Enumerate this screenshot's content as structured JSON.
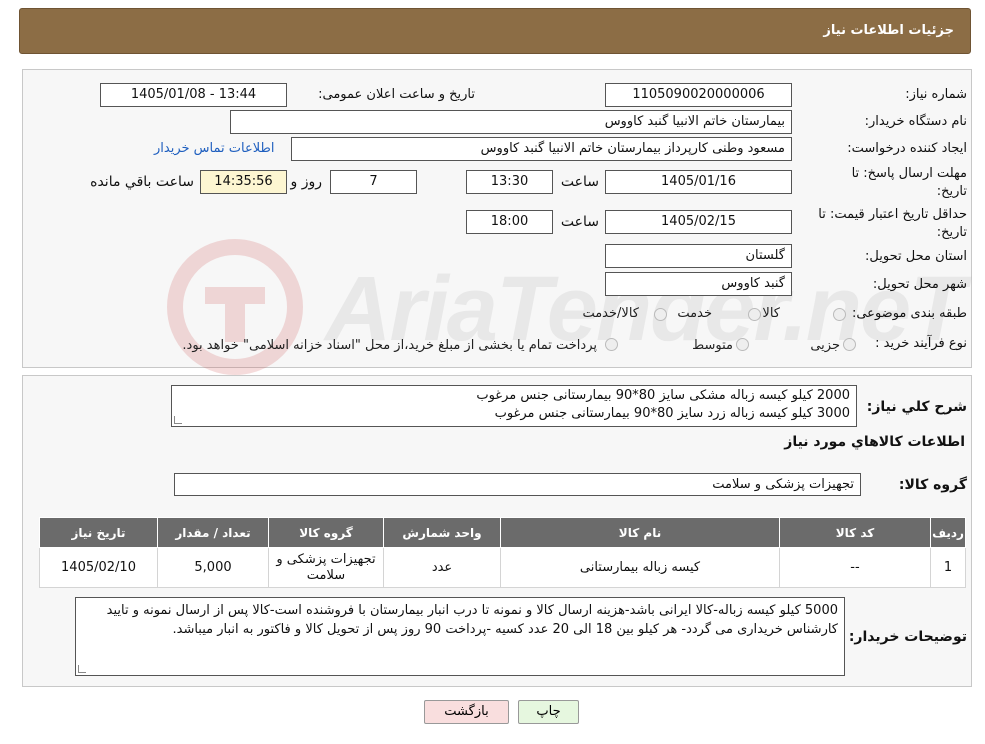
{
  "header": {
    "title": "جزئیات اطلاعات نیاز"
  },
  "fields": {
    "need_number_label": "شماره نیاز:",
    "need_number": "1105090020000006",
    "announce_label": "تاریخ و ساعت اعلان عمومی:",
    "announce_value": "1405/01/08 - 13:44",
    "buyer_org_label": "نام دستگاه خریدار:",
    "buyer_org": "بیمارستان خاتم الانبیا گنبد کاووس",
    "creator_label": "ایجاد کننده درخواست:",
    "creator": "مسعود وطنی کارپرداز بیمارستان خاتم الانبیا گنبد کاووس",
    "contact_link": "اطلاعات تماس خریدار",
    "deadline_label_1": "مهلت ارسال پاسخ: تا",
    "deadline_label_2": "تاریخ:",
    "deadline_date": "1405/01/16",
    "time_word": "ساعت",
    "deadline_time": "13:30",
    "days_value": "7",
    "days_word": "روز و",
    "remaining_time": "14:35:56",
    "remaining_word": "ساعت باقي مانده",
    "validity_label_1": "حداقل تاریخ اعتبار قیمت: تا",
    "validity_label_2": "تاریخ:",
    "validity_date": "1405/02/15",
    "validity_time": "18:00",
    "province_label": "استان محل تحویل:",
    "province": "گلستان",
    "city_label": "شهر محل تحویل:",
    "city": "گنبد کاووس",
    "category_label": "طبقه بندی موضوعی:",
    "category_options": [
      "کالا",
      "خدمت",
      "کالا/خدمت"
    ],
    "process_label": "نوع فرآیند خرید :",
    "process_options": [
      "جزیی",
      "متوسط"
    ],
    "process_note": "پرداخت تمام یا بخشی از مبلغ خرید،از محل \"اسناد خزانه اسلامی\" خواهد بود."
  },
  "summary": {
    "label": "شرح کلي نياز:",
    "line1": "2000 کیلو  کیسه زباله مشکی سایز 80*90 بیمارستانی جنس مرغوب",
    "line2": "3000 کیلو  کیسه  زباله  زرد  سایز   80*90 بیمارستانی جنس مرغوب"
  },
  "goods_info_title": "اطلاعات کالاهاي مورد نياز",
  "goods_group": {
    "label": "گروه کالا:",
    "value": "تجهیزات پزشکی و سلامت"
  },
  "table": {
    "headers": [
      "ردیف",
      "کد کالا",
      "نام کالا",
      "واحد شمارش",
      "گروه کالا",
      "تعداد / مقدار",
      "تاریخ نیاز"
    ],
    "rows": [
      {
        "row": "1",
        "code": "--",
        "name": "کیسه زباله بیمارستانی",
        "unit": "عدد",
        "group": "تجهیزات پزشکی و سلامت",
        "qty": "5,000",
        "date": "1405/02/10"
      }
    ]
  },
  "buyer_notes": {
    "label": "توضیحات خریدار:",
    "text": "5000 کیلو کیسه زباله-کالا ایرانی باشد-هزینه ارسال کالا و نمونه تا درب انبار بیمارستان با فروشنده است-کالا پس از ارسال نمونه و تایید کارشناس خریداری می گردد- هر کیلو بین 18 الی 20 عدد کسیه -پرداخت 90 روز پس از تحویل کالا و فاکتور به انبار میباشد."
  },
  "buttons": {
    "print": "چاپ",
    "back": "بازگشت"
  },
  "watermark_text": "AriaTender.neT",
  "colors": {
    "header_bg": "#8c6d45",
    "table_header_bg": "#6b6b6b",
    "back_button_bg": "#f9dede",
    "print_button_bg": "#e6f7df",
    "link": "#1f5fbf"
  }
}
